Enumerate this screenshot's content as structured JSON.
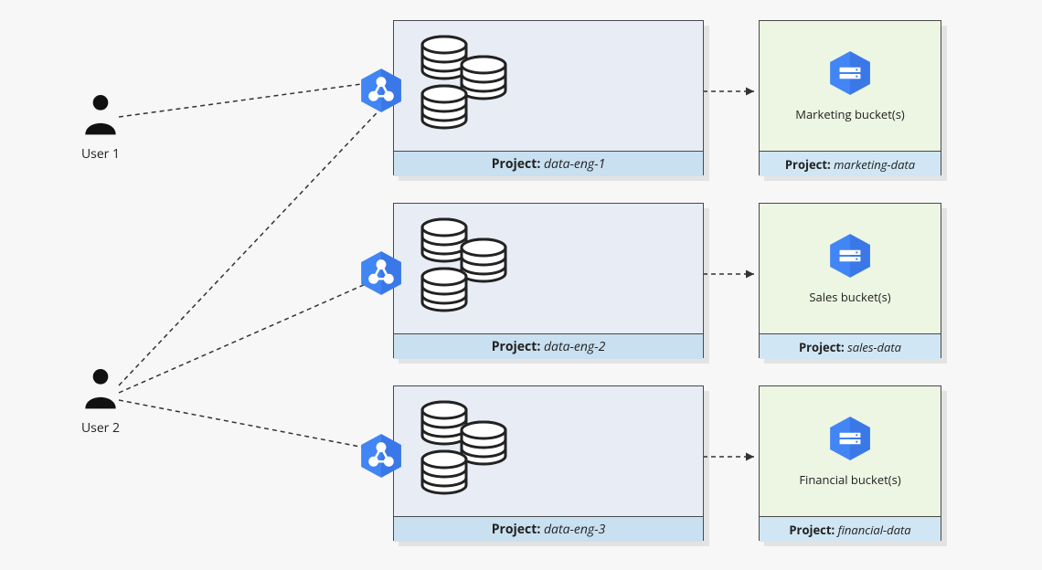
{
  "users": [
    {
      "label": "User 1"
    },
    {
      "label": "User 2"
    }
  ],
  "compute_projects": [
    {
      "footer_prefix": "Project:",
      "name": "data-eng-1"
    },
    {
      "footer_prefix": "Project:",
      "name": "data-eng-2"
    },
    {
      "footer_prefix": "Project:",
      "name": "data-eng-3"
    }
  ],
  "bucket_projects": [
    {
      "label": "Marketing bucket(s)",
      "footer_prefix": "Project:",
      "name": "marketing-data"
    },
    {
      "label": "Sales bucket(s)",
      "footer_prefix": "Project:",
      "name": "sales-data"
    },
    {
      "label": "Financial bucket(s)",
      "footer_prefix": "Project:",
      "name": "financial-data"
    }
  ],
  "colors": {
    "gcp_blue": "#4285f4",
    "gcp_blue_dark": "#3367d6"
  }
}
